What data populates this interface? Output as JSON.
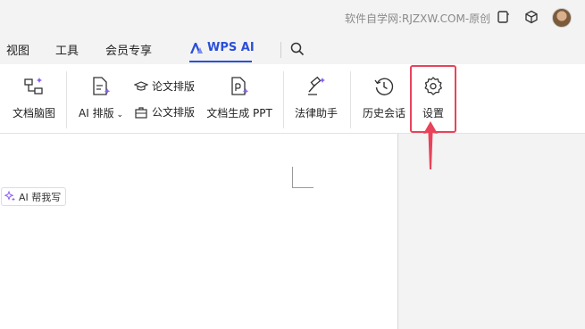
{
  "titlebar": {
    "watermark": "软件自学网:RJZXW.COM-原创",
    "icons": [
      "window-icon",
      "cube-icon",
      "avatar"
    ]
  },
  "menu": {
    "tabs": [
      {
        "label": "视图"
      },
      {
        "label": "工具"
      },
      {
        "label": "会员专享"
      }
    ],
    "active_tab": "WPS AI",
    "accent": "#2b4fd8"
  },
  "ribbon": {
    "mind_map": "文档脑图",
    "ai_layout": "AI 排版",
    "paper_layout": "论文排版",
    "official_layout": "公文排版",
    "gen_ppt": "文档生成 PPT",
    "law_assistant": "法律助手",
    "history": "历史会话",
    "settings": "设置"
  },
  "document": {
    "ai_write": "AI 帮我写"
  },
  "colors": {
    "highlight": "#e8435a",
    "ai_purple": "#8a5cf6"
  }
}
